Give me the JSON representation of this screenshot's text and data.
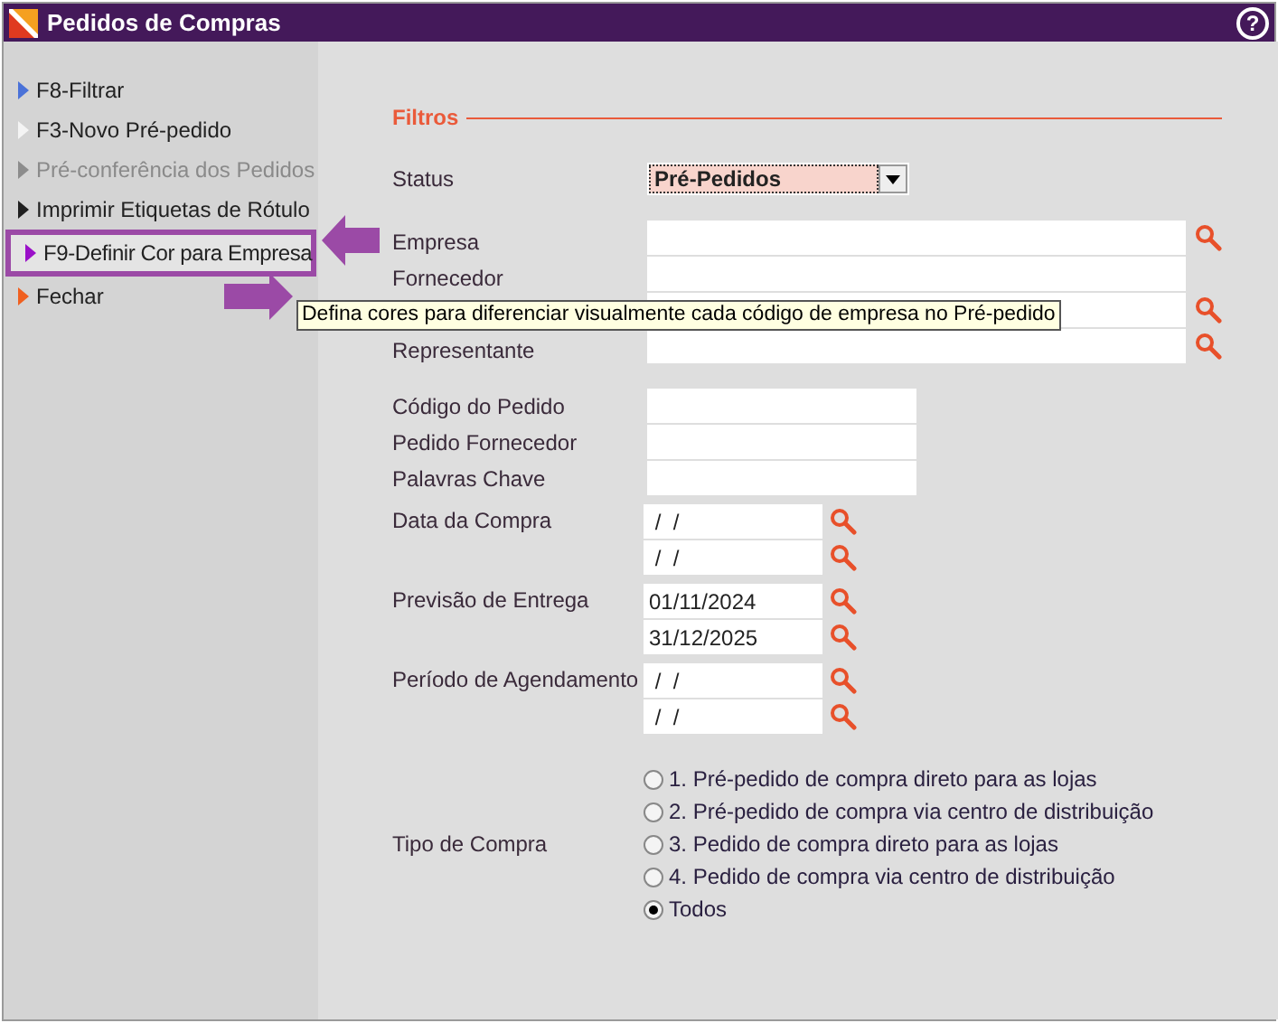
{
  "window": {
    "title": "Pedidos de Compras",
    "help": "?"
  },
  "sidebar": {
    "items": [
      {
        "label": "F8-Filtrar",
        "color": "#4a72d8",
        "disabled": false,
        "highlighted": false
      },
      {
        "label": "F3-Novo Pré-pedido",
        "color": "#f4f4f4",
        "disabled": false,
        "highlighted": false
      },
      {
        "label": "Pré-conferência dos Pedidos",
        "color": "#8c8c8c",
        "disabled": true,
        "highlighted": false
      },
      {
        "label": "Imprimir Etiquetas de Rótulo",
        "color": "#202020",
        "disabled": false,
        "highlighted": false
      },
      {
        "label": "F9-Definir Cor para Empresa",
        "color": "#9a10c8",
        "disabled": false,
        "highlighted": true
      },
      {
        "label": "Fechar",
        "color": "#f06020",
        "disabled": false,
        "highlighted": false
      }
    ]
  },
  "tooltip": "Defina cores para diferenciar visualmente cada código de empresa no Pré-pedido",
  "filters": {
    "title": "Filtros",
    "status": {
      "label": "Status",
      "value": "Pré-Pedidos"
    },
    "lookup_fields": [
      {
        "label": "Empresa",
        "search": true
      },
      {
        "label": "Fornecedor",
        "search": false
      },
      {
        "search": true
      },
      {
        "label": "Representante",
        "search": true
      }
    ],
    "text_fields": [
      {
        "label": "Código do Pedido"
      },
      {
        "label": "Pedido Fornecedor"
      },
      {
        "label": "Palavras Chave"
      }
    ],
    "date_ranges": [
      {
        "label": "Data da Compra",
        "from": " /  /",
        "to": " /  /"
      },
      {
        "label": "Previsão de Entrega",
        "from": "01/11/2024",
        "to": "31/12/2025"
      },
      {
        "label": "Período de Agendamento",
        "from": " /  /",
        "to": " /  /"
      }
    ],
    "purchase_type": {
      "label": "Tipo de Compra",
      "options": [
        {
          "label": "1. Pré-pedido de compra direto para as lojas",
          "selected": false
        },
        {
          "label": "2. Pré-pedido de compra via centro de distribuição",
          "selected": false
        },
        {
          "label": "3. Pedido de compra direto para as lojas",
          "selected": false
        },
        {
          "label": "4. Pedido de compra via centro de distribuição",
          "selected": false
        },
        {
          "label": "Todos",
          "selected": true
        }
      ]
    }
  }
}
